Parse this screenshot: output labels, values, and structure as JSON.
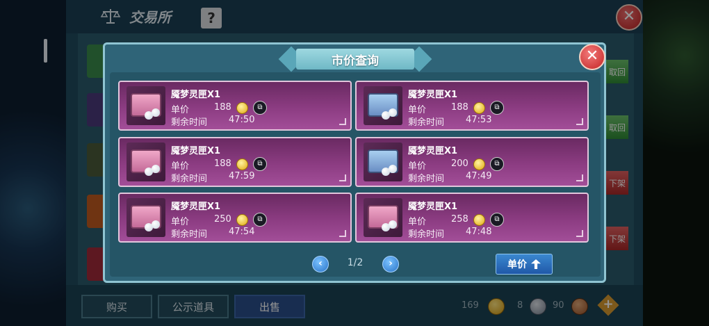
{
  "exchange": {
    "title": "交易所",
    "help": "?",
    "close": "✕",
    "side_buttons": [
      "取回",
      "取回",
      "下架",
      "下架"
    ],
    "tabs": [
      "购买",
      "公示道具",
      "出售"
    ],
    "active_tab": "出售",
    "currency": {
      "gold": "169",
      "silver": "8",
      "bronze": "90"
    },
    "add": "+"
  },
  "dialog": {
    "title": "市价查询",
    "close": "✕",
    "labels": {
      "unit_price": "单价",
      "time_left": "剩余时间"
    },
    "listings": [
      {
        "name": "魇梦灵匣X1",
        "price": "188",
        "time": "47:50",
        "chest": "pink"
      },
      {
        "name": "魇梦灵匣X1",
        "price": "188",
        "time": "47:53",
        "chest": "blue"
      },
      {
        "name": "魇梦灵匣X1",
        "price": "188",
        "time": "47:59",
        "chest": "pink"
      },
      {
        "name": "魇梦灵匣X1",
        "price": "200",
        "time": "47:49",
        "chest": "blue"
      },
      {
        "name": "魇梦灵匣X1",
        "price": "250",
        "time": "47:54",
        "chest": "pink"
      },
      {
        "name": "魇梦灵匣X1",
        "price": "258",
        "time": "47:48",
        "chest": "pink"
      }
    ],
    "pagination": {
      "prev": "‹",
      "next": "›",
      "label": "1/2"
    },
    "sort_button": "单价"
  }
}
